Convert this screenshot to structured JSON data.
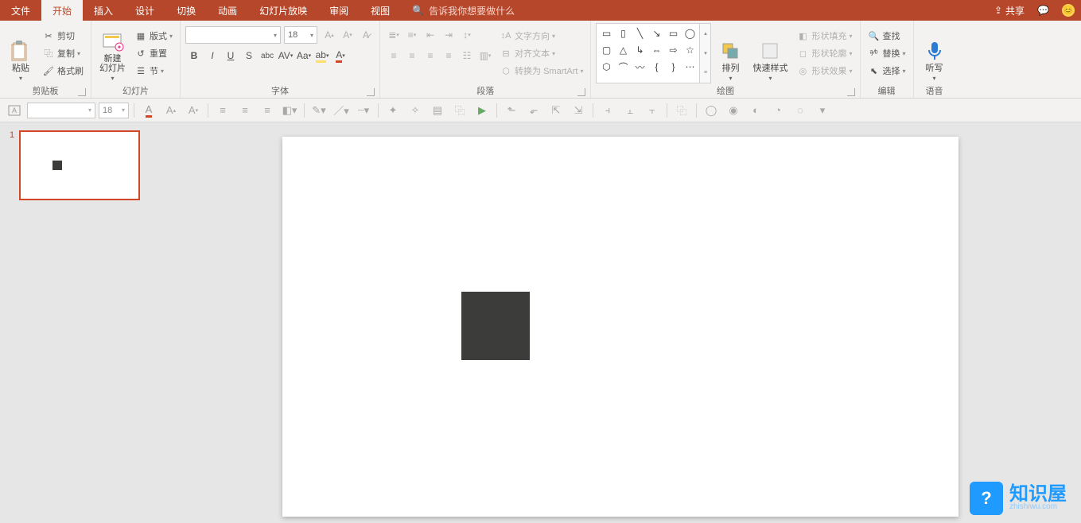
{
  "menubar": {
    "tabs": [
      "文件",
      "开始",
      "插入",
      "设计",
      "切换",
      "动画",
      "幻灯片放映",
      "审阅",
      "视图"
    ],
    "active_index": 1,
    "tellme_icon": "search-icon",
    "tellme": "告诉我你想要做什么",
    "share": "共享"
  },
  "ribbon": {
    "clipboard": {
      "label": "剪贴板",
      "paste": "粘贴",
      "cut": "剪切",
      "copy": "复制",
      "format_painter": "格式刷"
    },
    "slides": {
      "label": "幻灯片",
      "new_slide": "新建\n幻灯片",
      "layout": "版式",
      "reset": "重置",
      "section": "节"
    },
    "font": {
      "label": "字体",
      "size": "18"
    },
    "paragraph": {
      "label": "段落",
      "text_direction": "文字方向",
      "align_text": "对齐文本",
      "convert_smartart": "转换为 SmartArt"
    },
    "drawing": {
      "label": "绘图",
      "arrange": "排列",
      "quick_styles": "快速样式",
      "shape_fill": "形状填充",
      "shape_outline": "形状轮廓",
      "shape_effects": "形状效果"
    },
    "editing": {
      "label": "编辑",
      "find": "查找",
      "replace": "替换",
      "select": "选择"
    },
    "voice": {
      "label": "语音",
      "dictate": "听写"
    }
  },
  "toolbar2": {
    "font_size": "18"
  },
  "thumbs": {
    "items": [
      {
        "num": "1"
      }
    ]
  },
  "watermark": {
    "title": "知识屋",
    "sub": "zhishiwu.com"
  }
}
